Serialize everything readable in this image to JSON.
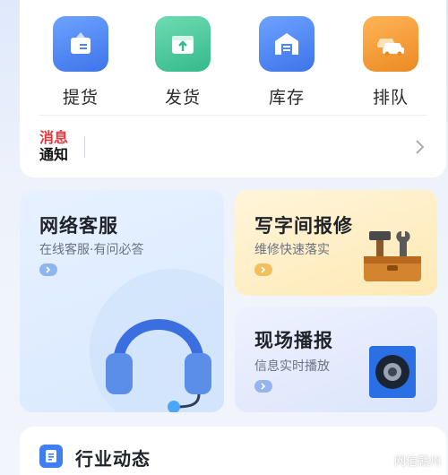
{
  "quick_actions": [
    {
      "label": "提货",
      "icon": "pickup-icon",
      "color": "#4d86f5"
    },
    {
      "label": "发货",
      "icon": "ship-icon",
      "color": "#3fc79a"
    },
    {
      "label": "库存",
      "icon": "warehouse-icon",
      "color": "#4d86f5"
    },
    {
      "label": "排队",
      "icon": "queue-cars-icon",
      "color": "#f29a36"
    }
  ],
  "notice": {
    "logo_line1": "消息",
    "logo_line2": "通知"
  },
  "tiles": {
    "service": {
      "title": "网络客服",
      "subtitle": "在线客服·有问必答"
    },
    "repair": {
      "title": "写字间报修",
      "subtitle": "维修快速落实"
    },
    "broadcast": {
      "title": "现场播报",
      "subtitle": "信息实时播放"
    }
  },
  "news": {
    "title": "行业动态"
  },
  "watermark": "网信赣州",
  "colors": {
    "accent": "#3f7ff2",
    "alert_red": "#e0393e",
    "orange": "#f29a36"
  }
}
